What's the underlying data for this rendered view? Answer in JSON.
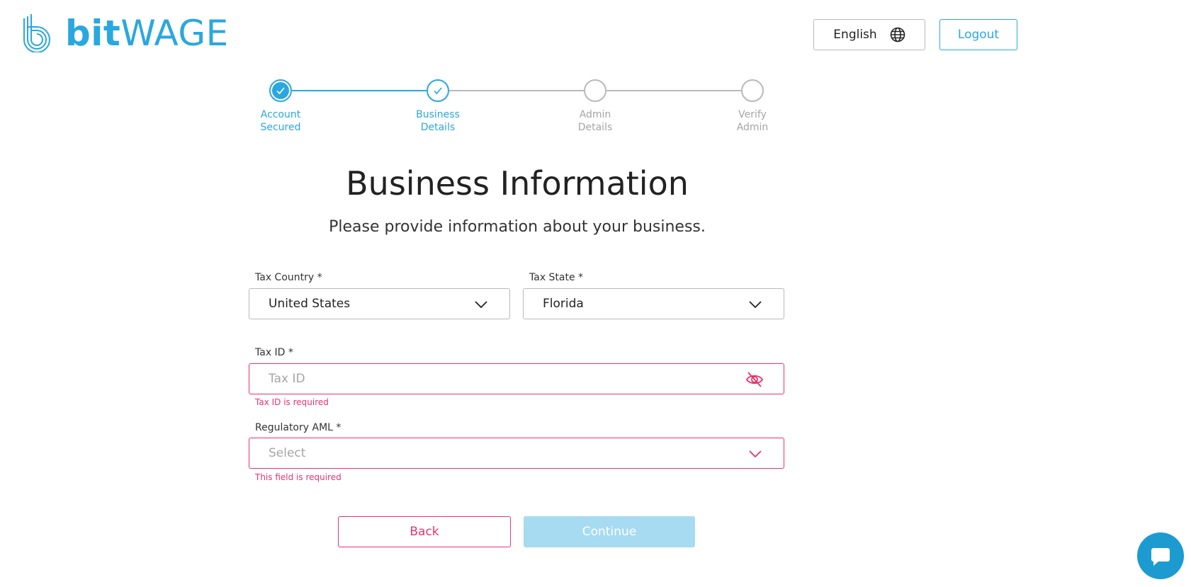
{
  "header": {
    "logo_bit": "bit",
    "logo_wage": "WAGE",
    "language_label": "English",
    "logout_label": "Logout"
  },
  "stepper": {
    "steps": [
      {
        "line1": "Account",
        "line2": "Secured",
        "state": "completed"
      },
      {
        "line1": "Business",
        "line2": "Details",
        "state": "current"
      },
      {
        "line1": "Admin",
        "line2": "Details",
        "state": "pending"
      },
      {
        "line1": "Verify",
        "line2": "Admin",
        "state": "pending"
      }
    ]
  },
  "main": {
    "title": "Business Information",
    "subtitle": "Please provide information about your business."
  },
  "form": {
    "tax_country": {
      "label": "Tax Country *",
      "value": "United States"
    },
    "tax_state": {
      "label": "Tax State *",
      "value": "Florida"
    },
    "tax_id": {
      "label": "Tax ID *",
      "placeholder": "Tax ID",
      "error": "Tax ID is required"
    },
    "regulatory_aml": {
      "label": "Regulatory AML *",
      "placeholder": "Select",
      "error": "This field is required"
    }
  },
  "actions": {
    "back_label": "Back",
    "continue_label": "Continue"
  },
  "colors": {
    "brand": "#2aa7df",
    "error": "#e8336e",
    "disabled_button": "#a6dbf2",
    "pending_step": "#b9b9b9"
  },
  "icons": {
    "language": "globe-icon",
    "tax_id_toggle": "eye-off-icon",
    "dropdown": "chevron-down-icon",
    "chat": "chat-bubble-icon"
  }
}
